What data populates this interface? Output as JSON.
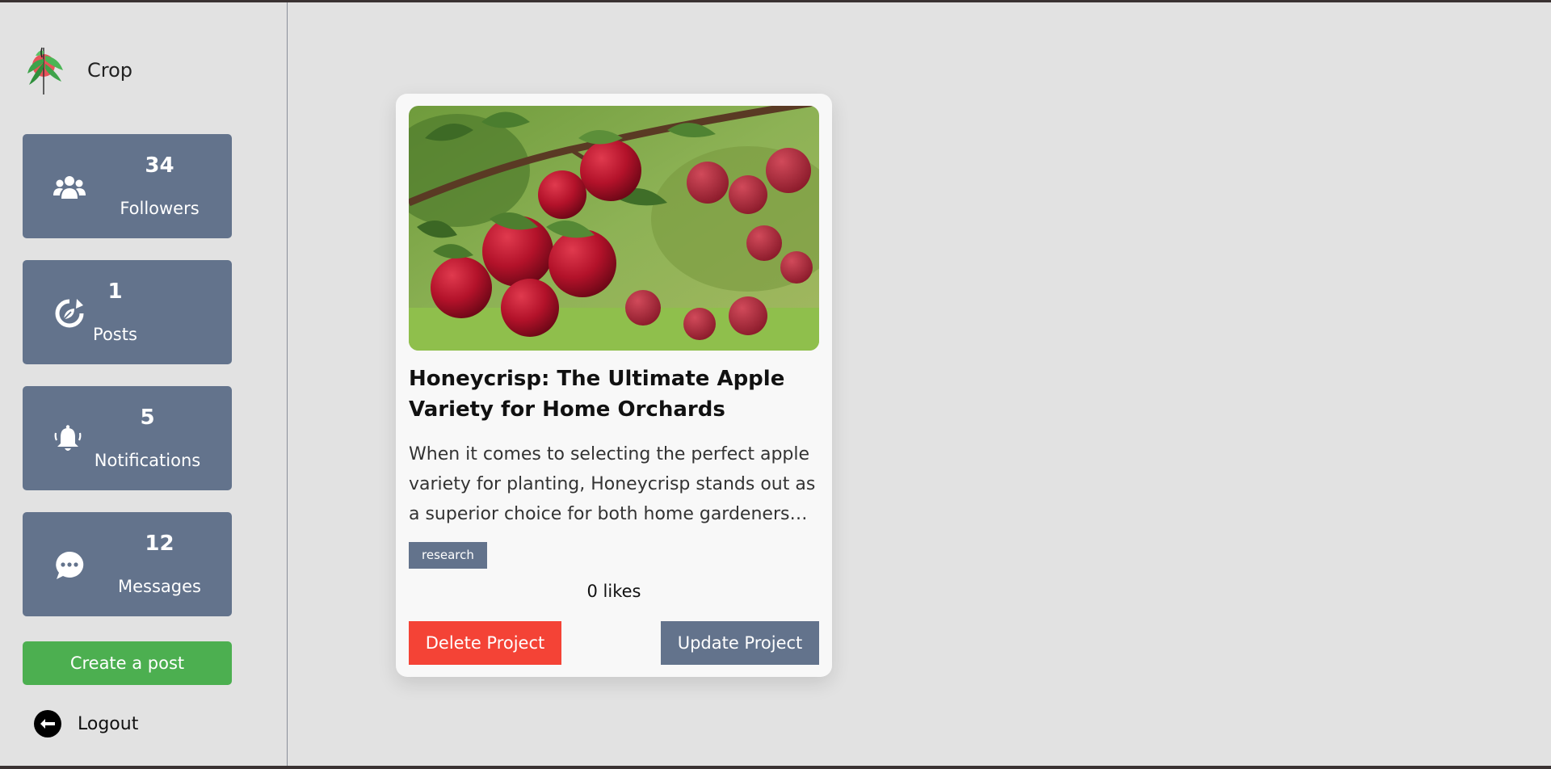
{
  "brand": {
    "name": "Crop"
  },
  "stats": [
    {
      "count": "34",
      "label": "Followers",
      "icon": "users-icon"
    },
    {
      "count": "1",
      "label": "Posts",
      "icon": "refresh-leaf-icon"
    },
    {
      "count": "5",
      "label": "Notifications",
      "icon": "bell-icon"
    },
    {
      "count": "12",
      "label": "Messages",
      "icon": "chat-icon"
    }
  ],
  "sidebar": {
    "create_label": "Create a post",
    "logout_label": "Logout"
  },
  "post": {
    "title": "Honeycrisp: The Ultimate Apple Variety for Home Orchards",
    "description": "When it comes to selecting the perfect apple variety for planting, Honeycrisp stands out as a superior choice for both home gardeners and...",
    "tag": "research",
    "likes": "0 likes",
    "delete_label": "Delete Project",
    "update_label": "Update Project"
  },
  "colors": {
    "card_slate": "#63738c",
    "create_green": "#4caf50",
    "delete_red": "#f44336"
  }
}
